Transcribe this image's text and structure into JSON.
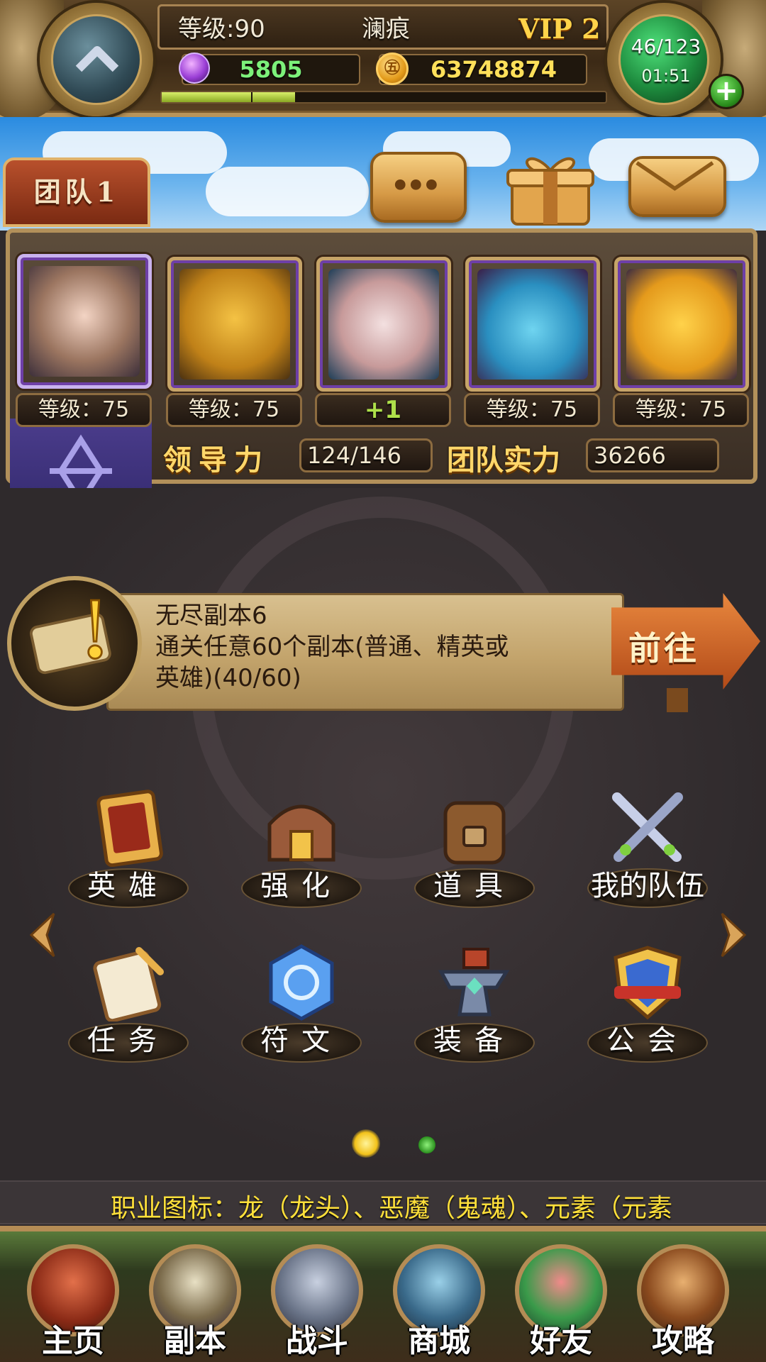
{
  "hud": {
    "level_text": "等级:90",
    "player_name": "澜痕",
    "vip_text": "VIP 2",
    "gems": "5805",
    "gold": "63748874",
    "energy": "46/123",
    "energy_timer": "01:51",
    "xp_progress": 0.3
  },
  "team": {
    "tab_label": "团队1",
    "heroes": [
      {
        "level_label": "等级：75"
      },
      {
        "level_label": "等级：75"
      },
      {
        "level_label": "+1"
      },
      {
        "level_label": "等级：75"
      },
      {
        "level_label": "等级：75"
      }
    ],
    "leadership_label": "领导力",
    "leadership_value": "124/146",
    "power_label": "团队实力",
    "power_value": "36266"
  },
  "quest": {
    "title": "无尽副本6",
    "desc_line1": "通关任意60个副本(普通、精英或",
    "desc_line2": "英雄)(40/60)",
    "go_label": "前往"
  },
  "menu": {
    "row1": [
      "英雄",
      "强化",
      "道具",
      "我的队伍"
    ],
    "row2": [
      "任务",
      "符文",
      "装备",
      "公会"
    ]
  },
  "pager": {
    "active_index": 0,
    "count": 2
  },
  "ticker": {
    "text": "职业图标：龙（龙头）、恶魔（鬼魂）、元素（元素"
  },
  "nav": [
    "主页",
    "副本",
    "战斗",
    "商城",
    "好友",
    "攻略"
  ],
  "colors": {
    "gem_green": "#7cf07a",
    "gold_yellow": "#ffe05a",
    "ticker_yellow": "#ffe03a"
  }
}
